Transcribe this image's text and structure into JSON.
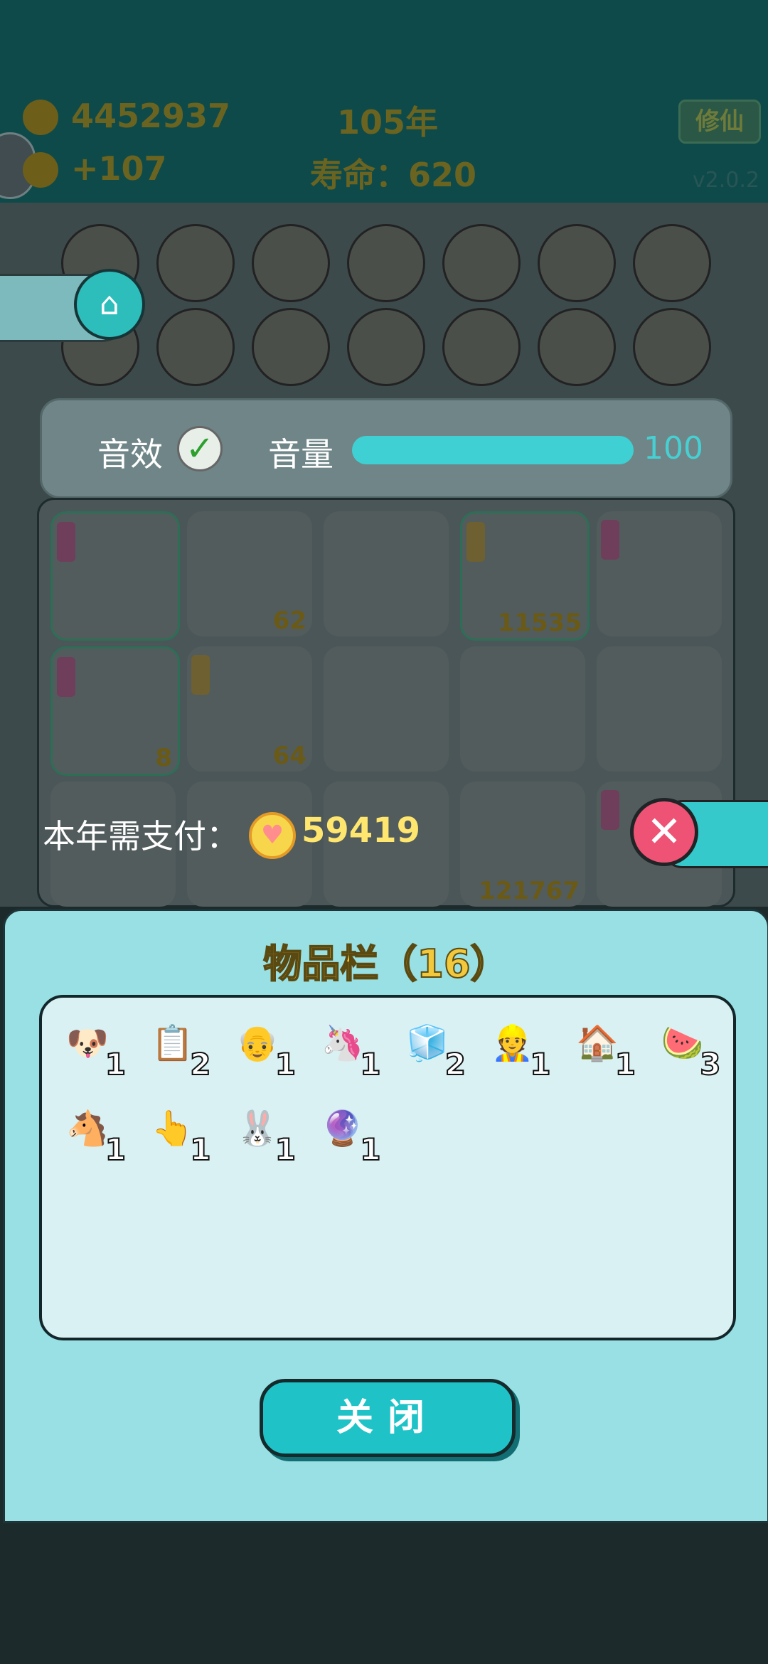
{
  "header": {
    "coins": "4452937",
    "income": "+107",
    "year": "105年",
    "lifespan": "寿命：620",
    "cultivate_badge": "修仙",
    "version": "v2.0.2"
  },
  "board_items": [
    {
      "icon": "cup-icon"
    },
    {
      "icon": "bowl-icon"
    },
    {
      "icon": "printer-icon"
    },
    {
      "icon": "ghost-icon"
    },
    {
      "icon": "unicorn-pair-icon"
    },
    {
      "icon": "chick-icon"
    },
    {
      "icon": "rice-bowl-icon"
    },
    {
      "icon": "bone-icon"
    },
    {
      "icon": "panda-icon"
    },
    {
      "icon": "minus-icon"
    },
    {
      "icon": "minus-icon"
    },
    {
      "icon": "wang-icon"
    },
    {
      "icon": "milk-tea-icon"
    },
    {
      "icon": "compass-icon"
    }
  ],
  "sound_panel": {
    "sound_label": "音效",
    "sound_enabled": true,
    "volume_label": "音量",
    "volume_value": "100",
    "volume_fraction": 1.0
  },
  "grid_cells": [
    {
      "icon": "copy-paste-icon",
      "count": "",
      "tag": "pink",
      "highlight": true
    },
    {
      "icon": "watermelon-icon",
      "count": "62",
      "tag": "",
      "highlight": false
    },
    {
      "icon": "horse-icon",
      "count": "",
      "tag": "",
      "highlight": false
    },
    {
      "icon": "king-dog-icon",
      "count": "11535",
      "tag": "yellow",
      "highlight": true
    },
    {
      "icon": "rabbit-house-icon",
      "count": "",
      "tag": "pink",
      "highlight": false
    },
    {
      "icon": "copy-paste-icon",
      "count": "8",
      "tag": "pink",
      "highlight": true
    },
    {
      "icon": "grandpa-icon",
      "count": "64",
      "tag": "yellow",
      "highlight": false
    },
    {
      "icon": "",
      "count": "",
      "tag": "",
      "highlight": false
    },
    {
      "icon": "",
      "count": "",
      "tag": "",
      "highlight": false
    },
    {
      "icon": "",
      "count": "",
      "tag": "",
      "highlight": false
    },
    {
      "icon": "watermelon-icon",
      "count": "",
      "tag": "",
      "highlight": false
    },
    {
      "icon": "watermelon-icon",
      "count": "",
      "tag": "",
      "highlight": false
    },
    {
      "icon": "",
      "count": "",
      "tag": "",
      "highlight": false
    },
    {
      "icon": "fridge-icon",
      "count": "121767",
      "tag": "",
      "highlight": false
    },
    {
      "icon": "",
      "count": "",
      "tag": "pink",
      "highlight": false
    }
  ],
  "payment": {
    "label": "本年需支付：",
    "amount": "59419"
  },
  "inventory": {
    "title": "物品栏（16）",
    "items": [
      {
        "icon": "king-dog-icon",
        "glyph": "🐶",
        "count": "1"
      },
      {
        "icon": "copy-paste-icon",
        "glyph": "📋",
        "count": "2"
      },
      {
        "icon": "grandpa-icon",
        "glyph": "👴",
        "count": "1"
      },
      {
        "icon": "unicorn-icon",
        "glyph": "🦄",
        "count": "1"
      },
      {
        "icon": "fridge-icon",
        "glyph": "🧊",
        "count": "2"
      },
      {
        "icon": "worker-icon",
        "glyph": "👷",
        "count": "1"
      },
      {
        "icon": "rabbit-house-icon",
        "glyph": "🏠",
        "count": "1"
      },
      {
        "icon": "watermelon-icon",
        "glyph": "🍉",
        "count": "3"
      },
      {
        "icon": "horse-icon",
        "glyph": "🐴",
        "count": "1"
      },
      {
        "icon": "pointing-hand-icon",
        "glyph": "👆",
        "count": "1"
      },
      {
        "icon": "rabbit-icon",
        "glyph": "🐰",
        "count": "1"
      },
      {
        "icon": "ball-icon",
        "glyph": "🔮",
        "count": "1"
      }
    ],
    "close_label": "关闭"
  }
}
